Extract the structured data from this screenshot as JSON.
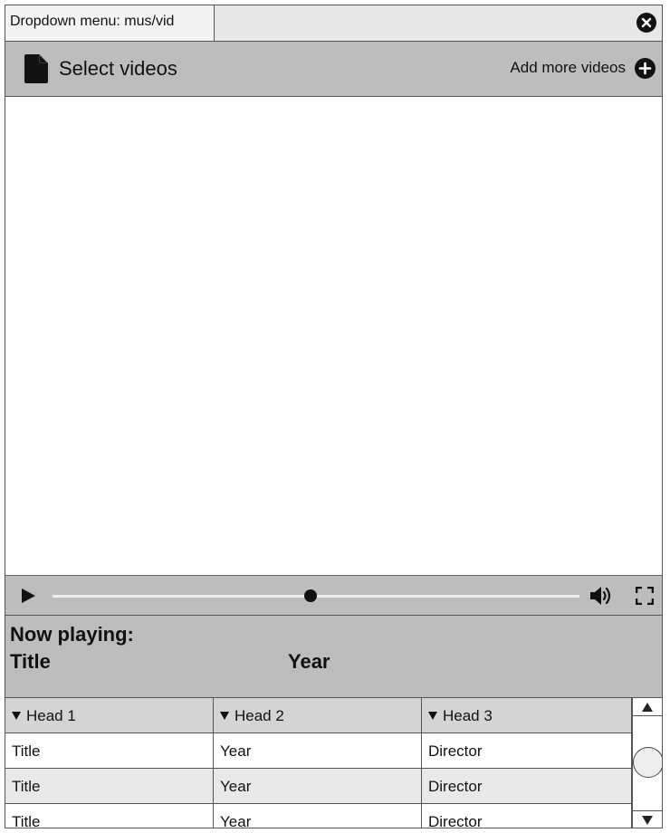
{
  "topbar": {
    "menu_label": "Dropdown menu: mus/vid",
    "close_icon": "close-icon"
  },
  "header": {
    "title": "Select videos",
    "file_icon": "file-icon",
    "add_label": "Add more videos",
    "add_icon": "plus-circle-icon"
  },
  "player": {
    "progress_fraction": 0.49,
    "play_icon": "play-icon",
    "volume_icon": "volume-icon",
    "fullscreen_icon": "fullscreen-icon"
  },
  "now_playing": {
    "label": "Now playing:",
    "title": "Title",
    "year": "Year"
  },
  "table": {
    "headers": [
      "Head 1",
      "Head 2",
      "Head 3"
    ],
    "rows": [
      [
        "Title",
        "Year",
        "Director"
      ],
      [
        "Title",
        "Year",
        "Director"
      ],
      [
        "Title",
        "Year",
        "Director"
      ]
    ]
  },
  "colors": {
    "panel": "#bdbdbd",
    "topbar": "#e7e7e7",
    "row_alt": "#e9e9e9",
    "border": "#555555"
  }
}
